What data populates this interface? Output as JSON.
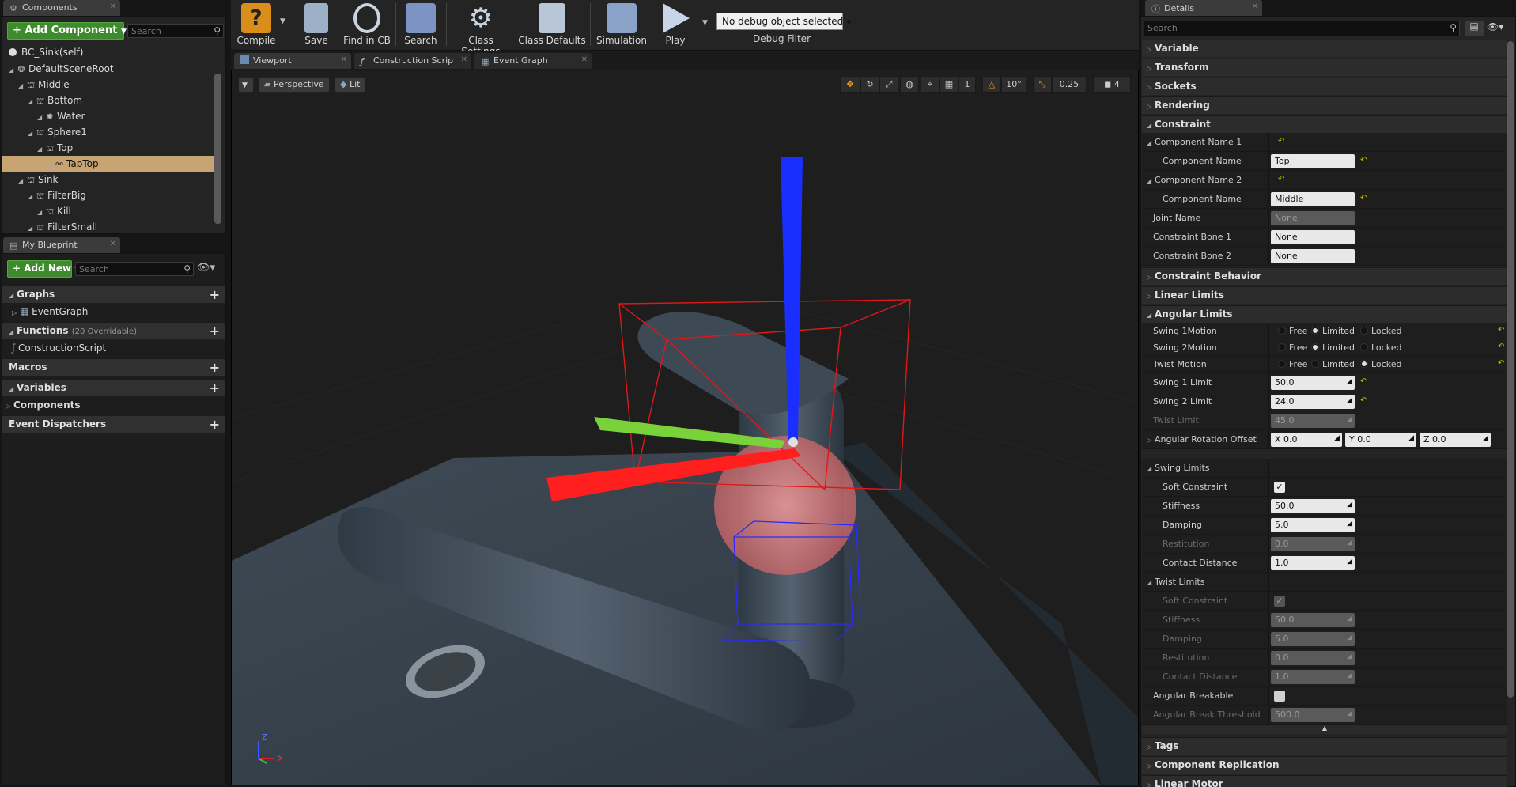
{
  "components_panel": {
    "tab_label": "Components",
    "add_button": "+ Add Component",
    "search_placeholder": "Search",
    "self_label": "BC_Sink(self)",
    "tree": [
      {
        "label": "DefaultSceneRoot",
        "depth": 0,
        "icon": "scene-root-icon"
      },
      {
        "label": "Middle",
        "depth": 1,
        "icon": "constraint-icon"
      },
      {
        "label": "Bottom",
        "depth": 2,
        "icon": "constraint-icon"
      },
      {
        "label": "Water",
        "depth": 3,
        "icon": "emitter-icon"
      },
      {
        "label": "Sphere1",
        "depth": 2,
        "icon": "constraint-icon"
      },
      {
        "label": "Top",
        "depth": 3,
        "icon": "constraint-icon"
      },
      {
        "label": "TapTop",
        "depth": 4,
        "icon": "physics-constraint-icon",
        "selected": true
      },
      {
        "label": "Sink",
        "depth": 1,
        "icon": "constraint-icon"
      },
      {
        "label": "FilterBig",
        "depth": 2,
        "icon": "constraint-icon"
      },
      {
        "label": "Kill",
        "depth": 3,
        "icon": "constraint-icon"
      },
      {
        "label": "FilterSmall",
        "depth": 2,
        "icon": "constraint-icon"
      }
    ]
  },
  "blueprint_panel": {
    "tab_label": "My Blueprint",
    "add_button": "+ Add New",
    "search_placeholder": "Search",
    "graphs_label": "Graphs",
    "event_graph_label": "EventGraph",
    "functions_label": "Functions",
    "functions_count": "(20 Overridable)",
    "construction_script_label": "ConstructionScript",
    "macros_label": "Macros",
    "variables_label": "Variables",
    "components_label": "Components",
    "event_dispatchers_label": "Event Dispatchers"
  },
  "toolbar": {
    "compile": "Compile",
    "save": "Save",
    "find_in_cb": "Find in CB",
    "search": "Search",
    "class_settings": "Class Settings",
    "class_defaults": "Class Defaults",
    "simulation": "Simulation",
    "play": "Play",
    "debug_dropdown": "No debug object selected",
    "debug_filter": "Debug Filter"
  },
  "editor_tabs": {
    "viewport": "Viewport",
    "construction_script": "Construction Scrip",
    "event_graph": "Event Graph"
  },
  "viewport": {
    "perspective": "Perspective",
    "lit": "Lit",
    "grid_snap": "1",
    "rotation_snap": "10°",
    "scale_snap": "0.25",
    "camera_speed": "4",
    "axis_z": "Z",
    "axis_x": "X"
  },
  "details": {
    "tab_label": "Details",
    "search_placeholder": "Search",
    "categories": {
      "variable": "Variable",
      "transform": "Transform",
      "sockets": "Sockets",
      "rendering": "Rendering",
      "constraint": "Constraint",
      "constraint_behavior": "Constraint Behavior",
      "linear_limits": "Linear Limits",
      "angular_limits": "Angular Limits",
      "tags": "Tags",
      "component_replication": "Component Replication",
      "linear_motor": "Linear Motor"
    },
    "constraint": {
      "component_name_1": "Component Name 1",
      "component_name_label": "Component Name",
      "component_name_1_value": "Top",
      "component_name_2": "Component Name 2",
      "component_name_2_value": "Middle",
      "joint_name": "Joint Name",
      "joint_name_value": "None",
      "constraint_bone_1": "Constraint Bone 1",
      "constraint_bone_1_value": "None",
      "constraint_bone_2": "Constraint Bone 2",
      "constraint_bone_2_value": "None"
    },
    "angular": {
      "swing1_motion": "Swing 1Motion",
      "swing2_motion": "Swing 2Motion",
      "twist_motion": "Twist Motion",
      "opt_free": "Free",
      "opt_limited": "Limited",
      "opt_locked": "Locked",
      "swing1_limit": "Swing 1 Limit",
      "swing1_limit_value": "50.0",
      "swing2_limit": "Swing 2 Limit",
      "swing2_limit_value": "24.0",
      "twist_limit": "Twist Limit",
      "twist_limit_value": "45.0",
      "rotation_offset": "Angular Rotation Offset",
      "offset_x": "X  0.0",
      "offset_y": "Y  0.0",
      "offset_z": "Z  0.0",
      "swing_limits": "Swing Limits",
      "twist_limits": "Twist Limits",
      "soft_constraint": "Soft Constraint",
      "stiffness": "Stiffness",
      "damping": "Damping",
      "restitution": "Restitution",
      "contact_distance": "Contact Distance",
      "swing_stiffness": "50.0",
      "swing_damping": "5.0",
      "swing_restitution": "0.0",
      "swing_contact": "1.0",
      "twist_stiffness": "50.0",
      "twist_damping": "5.0",
      "twist_restitution": "0.0",
      "twist_contact": "1.0",
      "angular_breakable": "Angular Breakable",
      "angular_break_threshold": "Angular Break Threshold",
      "angular_break_threshold_value": "500.0"
    }
  }
}
